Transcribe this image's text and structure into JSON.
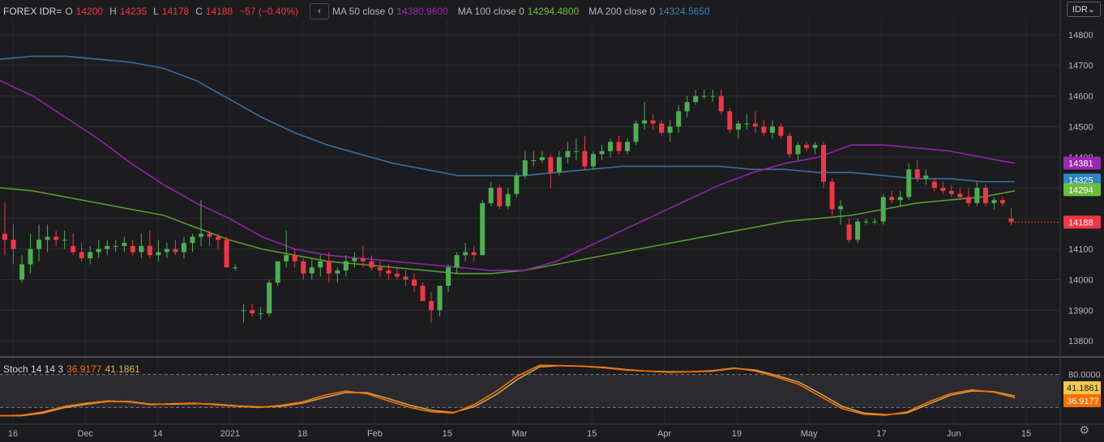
{
  "legend": {
    "symbol": "FOREX IDR=",
    "o_label": "O",
    "o_value": "14200",
    "h_label": "H",
    "h_value": "14235",
    "l_label": "L",
    "l_value": "14178",
    "c_label": "C",
    "c_value": "14188",
    "change": "−57 (−0.40%)",
    "collapse_glyph": "‹",
    "ma50_label": "MA 50 close 0",
    "ma50_value": "14380.9600",
    "ma100_label": "MA 100 close 0",
    "ma100_value": "14294.4800",
    "ma200_label": "MA 200 close 0",
    "ma200_value": "14324.5650"
  },
  "currency_button": "IDR⌄",
  "stoch_legend": {
    "label": "Stoch 14 14 3",
    "k_value": "36.9177",
    "d_value": "41.1861"
  },
  "colors": {
    "up": "#26a69a",
    "bull": "#4caf50",
    "down": "#f23645",
    "ma50": "#9c27b0",
    "ma100": "#6bbe3c",
    "ma200": "#2962ff",
    "k": "#ff6d00",
    "d": "#e0b44a"
  },
  "price_axis_ticks": [
    "14800",
    "14700",
    "14600",
    "14500",
    "14400",
    "14300",
    "14200",
    "14100",
    "14000",
    "13900",
    "13800"
  ],
  "price_tags": [
    {
      "text": "14381",
      "color": "#9c27b0",
      "value": 14381
    },
    {
      "text": "14325",
      "color": "#2e86c1",
      "value": 14325
    },
    {
      "text": "14294",
      "color": "#6bbe3c",
      "value": 14294
    },
    {
      "text": "14188",
      "color": "#f23645",
      "value": 14188
    }
  ],
  "stoch_axis": {
    "upper": "80.0000",
    "d_tag": "41.1861",
    "k_tag": "36.9177"
  },
  "time_labels": [
    "16",
    "Dec",
    "14",
    "2021",
    "18",
    "Feb",
    "15",
    "Mar",
    "15",
    "Apr",
    "19",
    "May",
    "17",
    "Jun",
    "15"
  ],
  "chart_data": {
    "type": "candlestick",
    "y_range": [
      13750,
      14850
    ],
    "stoch_range": [
      0,
      100
    ],
    "candles": [
      [
        14150,
        14250,
        14080,
        14130
      ],
      [
        14130,
        14180,
        14050,
        14100
      ],
      [
        14000,
        14080,
        13990,
        14050
      ],
      [
        14050,
        14150,
        14020,
        14100
      ],
      [
        14100,
        14180,
        14060,
        14130
      ],
      [
        14130,
        14180,
        14090,
        14140
      ],
      [
        14140,
        14160,
        14110,
        14130
      ],
      [
        14130,
        14160,
        14100,
        14130
      ],
      [
        14110,
        14150,
        14080,
        14090
      ],
      [
        14090,
        14120,
        14060,
        14070
      ],
      [
        14070,
        14110,
        14050,
        14090
      ],
      [
        14090,
        14130,
        14070,
        14100
      ],
      [
        14100,
        14130,
        14080,
        14110
      ],
      [
        14110,
        14130,
        14090,
        14110
      ],
      [
        14110,
        14140,
        14090,
        14120
      ],
      [
        14110,
        14130,
        14080,
        14090
      ],
      [
        14090,
        14150,
        14070,
        14110
      ],
      [
        14110,
        14160,
        14070,
        14080
      ],
      [
        14080,
        14130,
        14060,
        14090
      ],
      [
        14090,
        14120,
        14070,
        14100
      ],
      [
        14100,
        14130,
        14080,
        14090
      ],
      [
        14090,
        14140,
        14070,
        14120
      ],
      [
        14120,
        14150,
        14090,
        14140
      ],
      [
        14140,
        14260,
        14110,
        14150
      ],
      [
        14150,
        14160,
        14110,
        14140
      ],
      [
        14140,
        14150,
        14100,
        14130
      ],
      [
        14130,
        14140,
        14040,
        14040
      ],
      [
        14040,
        14050,
        14030,
        14040
      ],
      [
        13900,
        13920,
        13860,
        13900
      ],
      [
        13900,
        13920,
        13880,
        13890
      ],
      [
        13890,
        13910,
        13870,
        13890
      ],
      [
        13890,
        14000,
        13880,
        13990
      ],
      [
        13990,
        14060,
        13980,
        14060
      ],
      [
        14060,
        14160,
        14040,
        14080
      ],
      [
        14080,
        14100,
        14040,
        14060
      ],
      [
        14060,
        14070,
        14000,
        14020
      ],
      [
        14020,
        14070,
        14000,
        14040
      ],
      [
        14040,
        14080,
        14010,
        14060
      ],
      [
        14060,
        14090,
        13990,
        14020
      ],
      [
        14020,
        14040,
        13990,
        14030
      ],
      [
        14030,
        14080,
        14010,
        14060
      ],
      [
        14060,
        14090,
        14040,
        14070
      ],
      [
        14070,
        14110,
        14040,
        14060
      ],
      [
        14060,
        14080,
        14030,
        14040
      ],
      [
        14040,
        14060,
        14010,
        14030
      ],
      [
        14030,
        14050,
        14000,
        14020
      ],
      [
        14020,
        14040,
        14000,
        14010
      ],
      [
        14010,
        14030,
        13980,
        14000
      ],
      [
        14000,
        14020,
        13960,
        13980
      ],
      [
        13980,
        13990,
        13930,
        13930
      ],
      [
        13930,
        13960,
        13860,
        13900
      ],
      [
        13900,
        13980,
        13880,
        13980
      ],
      [
        13980,
        14050,
        13960,
        14040
      ],
      [
        14040,
        14090,
        14020,
        14080
      ],
      [
        14080,
        14120,
        14060,
        14090
      ],
      [
        14090,
        14110,
        14060,
        14080
      ],
      [
        14080,
        14260,
        14080,
        14250
      ],
      [
        14250,
        14320,
        14240,
        14300
      ],
      [
        14300,
        14310,
        14230,
        14240
      ],
      [
        14240,
        14300,
        14230,
        14280
      ],
      [
        14280,
        14350,
        14270,
        14340
      ],
      [
        14340,
        14420,
        14330,
        14390
      ],
      [
        14390,
        14420,
        14370,
        14390
      ],
      [
        14390,
        14420,
        14380,
        14400
      ],
      [
        14400,
        14410,
        14300,
        14350
      ],
      [
        14350,
        14420,
        14340,
        14400
      ],
      [
        14400,
        14450,
        14380,
        14420
      ],
      [
        14420,
        14460,
        14390,
        14420
      ],
      [
        14420,
        14470,
        14360,
        14370
      ],
      [
        14370,
        14420,
        14360,
        14410
      ],
      [
        14410,
        14440,
        14390,
        14420
      ],
      [
        14420,
        14460,
        14400,
        14450
      ],
      [
        14450,
        14470,
        14410,
        14420
      ],
      [
        14420,
        14460,
        14410,
        14450
      ],
      [
        14450,
        14520,
        14440,
        14510
      ],
      [
        14510,
        14580,
        14490,
        14520
      ],
      [
        14520,
        14540,
        14490,
        14510
      ],
      [
        14510,
        14520,
        14470,
        14480
      ],
      [
        14480,
        14520,
        14450,
        14500
      ],
      [
        14500,
        14570,
        14480,
        14550
      ],
      [
        14550,
        14600,
        14530,
        14580
      ],
      [
        14580,
        14620,
        14570,
        14600
      ],
      [
        14600,
        14620,
        14590,
        14600
      ],
      [
        14600,
        14620,
        14580,
        14600
      ],
      [
        14600,
        14620,
        14540,
        14550
      ],
      [
        14550,
        14560,
        14480,
        14490
      ],
      [
        14490,
        14520,
        14460,
        14510
      ],
      [
        14510,
        14540,
        14490,
        14510
      ],
      [
        14510,
        14550,
        14480,
        14500
      ],
      [
        14500,
        14520,
        14470,
        14480
      ],
      [
        14480,
        14520,
        14460,
        14500
      ],
      [
        14500,
        14510,
        14460,
        14470
      ],
      [
        14470,
        14480,
        14400,
        14410
      ],
      [
        14410,
        14450,
        14390,
        14440
      ],
      [
        14440,
        14450,
        14420,
        14430
      ],
      [
        14430,
        14450,
        14410,
        14440
      ],
      [
        14440,
        14450,
        14300,
        14320
      ],
      [
        14320,
        14330,
        14210,
        14230
      ],
      [
        14230,
        14260,
        14180,
        14240
      ],
      [
        14180,
        14200,
        14120,
        14130
      ],
      [
        14130,
        14200,
        14120,
        14190
      ],
      [
        14190,
        14200,
        14180,
        14190
      ],
      [
        14190,
        14200,
        14180,
        14190
      ],
      [
        14190,
        14280,
        14180,
        14270
      ],
      [
        14270,
        14290,
        14250,
        14260
      ],
      [
        14260,
        14290,
        14240,
        14270
      ],
      [
        14270,
        14380,
        14260,
        14360
      ],
      [
        14360,
        14390,
        14320,
        14330
      ],
      [
        14330,
        14360,
        14310,
        14340
      ],
      [
        14320,
        14330,
        14290,
        14300
      ],
      [
        14300,
        14320,
        14280,
        14290
      ],
      [
        14290,
        14310,
        14270,
        14280
      ],
      [
        14280,
        14300,
        14260,
        14270
      ],
      [
        14270,
        14300,
        14240,
        14250
      ],
      [
        14250,
        14320,
        14240,
        14300
      ],
      [
        14300,
        14310,
        14240,
        14250
      ],
      [
        14250,
        14270,
        14230,
        14260
      ],
      [
        14260,
        14270,
        14240,
        14250
      ],
      [
        14200,
        14235,
        14178,
        14188
      ]
    ],
    "ma50": [
      14650,
      14600,
      14530,
      14460,
      14380,
      14310,
      14250,
      14200,
      14140,
      14100,
      14080,
      14070,
      14060,
      14050,
      14040,
      14030,
      14030,
      14060,
      14110,
      14160,
      14210,
      14260,
      14310,
      14350,
      14380,
      14400,
      14440,
      14440,
      14430,
      14420,
      14400,
      14380
    ],
    "ma100": [
      14300,
      14290,
      14270,
      14250,
      14230,
      14210,
      14170,
      14130,
      14100,
      14080,
      14060,
      14050,
      14040,
      14030,
      14020,
      14020,
      14030,
      14050,
      14070,
      14090,
      14110,
      14130,
      14150,
      14170,
      14190,
      14200,
      14210,
      14230,
      14250,
      14260,
      14270,
      14290
    ],
    "ma200": [
      14720,
      14730,
      14730,
      14720,
      14710,
      14690,
      14650,
      14590,
      14530,
      14480,
      14440,
      14410,
      14380,
      14360,
      14340,
      14340,
      14340,
      14350,
      14360,
      14370,
      14370,
      14370,
      14370,
      14360,
      14360,
      14350,
      14350,
      14340,
      14330,
      14330,
      14320,
      14320
    ],
    "stoch_k": [
      5,
      6,
      12,
      22,
      28,
      32,
      30,
      25,
      27,
      28,
      25,
      22,
      20,
      24,
      30,
      42,
      50,
      45,
      32,
      20,
      12,
      10,
      26,
      50,
      78,
      97,
      96,
      95,
      92,
      88,
      86,
      84,
      85,
      87,
      92,
      86,
      75,
      62,
      40,
      18,
      8,
      6,
      12,
      30,
      45,
      52,
      48,
      38
    ],
    "stoch_d": [
      5,
      5,
      10,
      20,
      26,
      31,
      31,
      26,
      26,
      27,
      26,
      23,
      21,
      22,
      28,
      38,
      47,
      47,
      36,
      24,
      15,
      11,
      22,
      44,
      72,
      94,
      96,
      95,
      93,
      89,
      86,
      85,
      85,
      86,
      91,
      88,
      78,
      66,
      45,
      22,
      10,
      7,
      10,
      26,
      42,
      50,
      49,
      41
    ],
    "stoch_upper": 80,
    "stoch_lower": 20
  }
}
